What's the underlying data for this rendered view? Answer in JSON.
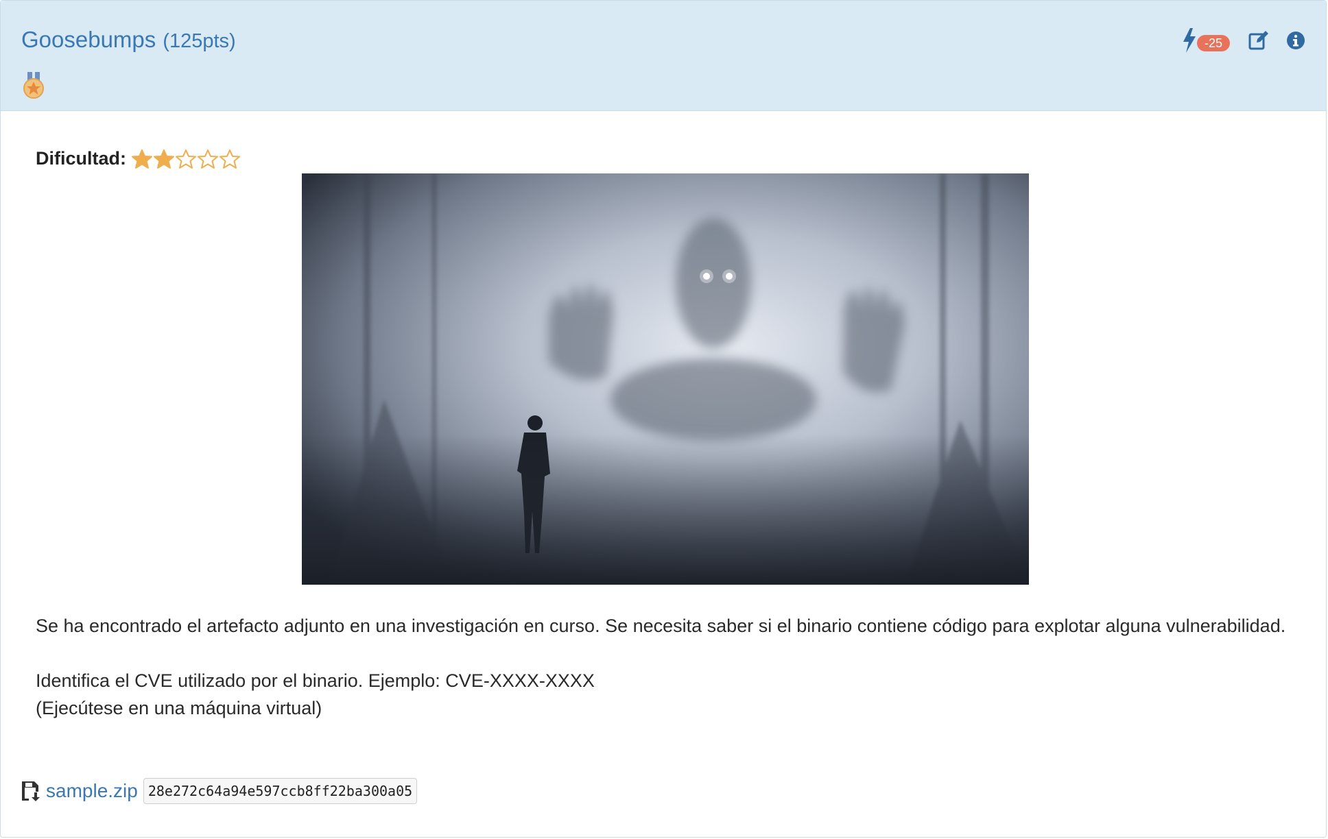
{
  "challenge": {
    "title": "Goosebumps",
    "points": "(125pts)",
    "hint_badge": "-25",
    "difficulty_label": "Dificultad:",
    "difficulty_rating": 2,
    "difficulty_max": 5
  },
  "icons": {
    "medal": "medal-icon",
    "hint": "bolt-icon",
    "edit": "edit-icon",
    "info": "info-icon",
    "download": "floppy-download-icon"
  },
  "description": {
    "paragraph1": "Se ha encontrado el artefacto adjunto en una investigación en curso. Se necesita saber si el binario contiene código para explotar alguna vulnerabilidad.",
    "paragraph2_line1": "Identifica el CVE utilizado por el binario. Ejemplo: CVE-XXXX-XXXX",
    "paragraph2_line2": "(Ejecútese en una máquina virtual)"
  },
  "attachment": {
    "filename": "sample.zip",
    "hash": "28e272c64a94e597ccb8ff22ba300a05"
  },
  "colors": {
    "header_bg": "#d9eaf5",
    "link": "#3a78b4",
    "badge": "#e8735a",
    "star": "#f0ad4e"
  }
}
